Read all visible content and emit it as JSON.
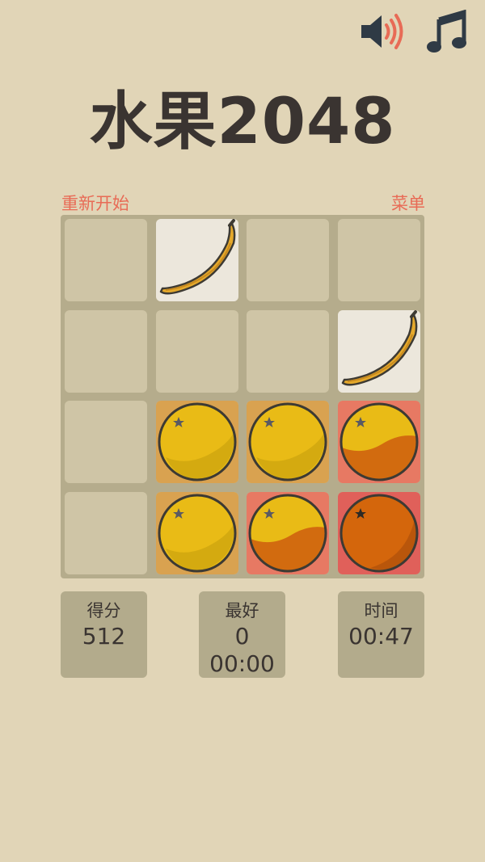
{
  "title": "水果2048",
  "actions": {
    "restart": "重新开始",
    "menu": "菜单"
  },
  "icons": [
    "sound-on-icon",
    "music-note-icon"
  ],
  "colors": {
    "accent": "#e86b56",
    "banana_tile": "#ece7dc",
    "orange_tile": "#d9a250",
    "tangerine_tile": "#e77963",
    "blood_orange_tile": "#e0605a"
  },
  "board": {
    "rows": [
      [
        "",
        "banana",
        "",
        ""
      ],
      [
        "",
        "",
        "",
        "banana"
      ],
      [
        "",
        "yellow-orange",
        "yellow-orange",
        "tangerine"
      ],
      [
        "",
        "yellow-orange",
        "tangerine",
        "red-orange"
      ]
    ]
  },
  "stats": {
    "score": {
      "label": "得分",
      "value": "512"
    },
    "best": {
      "label": "最好",
      "value": "0",
      "time": "00:00"
    },
    "time": {
      "label": "时间",
      "value": "00:47"
    }
  }
}
